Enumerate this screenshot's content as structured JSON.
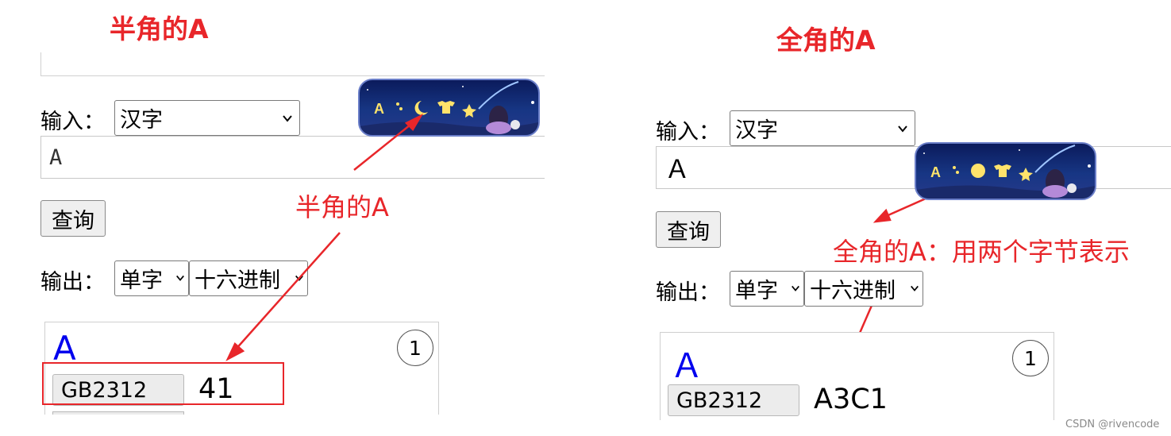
{
  "left": {
    "title": "半角的A",
    "input_label": "输入：",
    "input_type_select": "汉字",
    "input_value": "A",
    "query_button": "查询",
    "output_label": "输出：",
    "output_mode_select": "单字",
    "output_format_select": "十六进制",
    "result": {
      "glyph": "A",
      "count": "1",
      "encoding_label": "GB2312",
      "hex_value": "41"
    },
    "annotation": "半角的A"
  },
  "right": {
    "title": "全角的A",
    "input_label": "输入：",
    "input_type_select": "汉字",
    "input_value": "Ａ",
    "query_button": "查询",
    "output_label": "输出：",
    "output_mode_select": "单字",
    "output_format_select": "十六进制",
    "result": {
      "glyph": "Ａ",
      "count": "1",
      "encoding_label": "GB2312",
      "hex_value": "A3C1"
    },
    "annotation": "全角的A：用两个字节表示"
  },
  "badge": {
    "letter": "A"
  },
  "credit": "CSDN @rivencode",
  "colors": {
    "accent_red": "#e8262a",
    "glyph_blue": "#0000ee"
  }
}
